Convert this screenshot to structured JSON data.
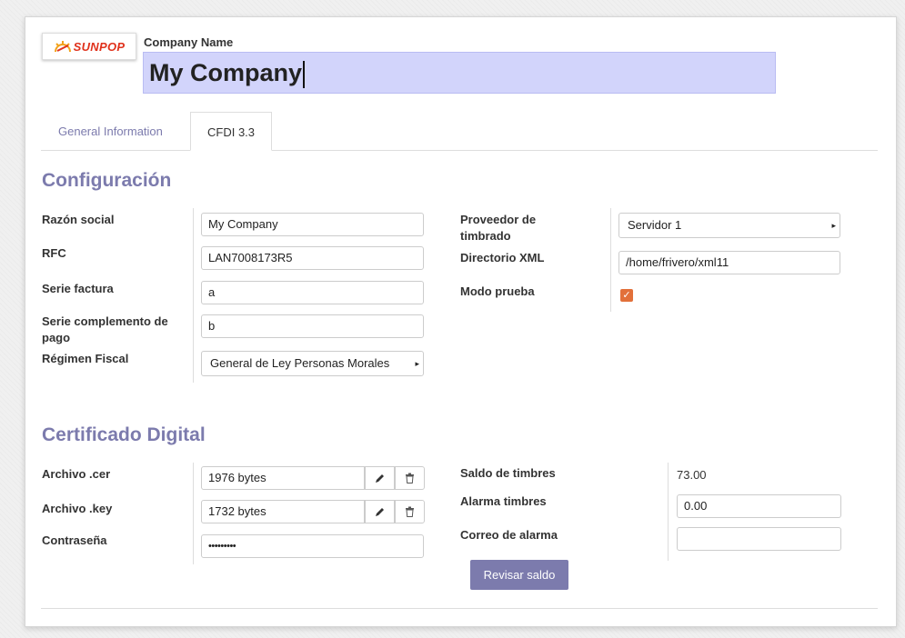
{
  "header": {
    "logo_text": "SUNPOP",
    "company_label": "Company Name",
    "company_value": "My Company"
  },
  "tabs": [
    {
      "label": "General Information",
      "active": false
    },
    {
      "label": "CFDI 3.3",
      "active": true
    }
  ],
  "configuracion": {
    "title": "Configuración",
    "razon_social": {
      "label": "Razón social",
      "value": "My Company"
    },
    "rfc": {
      "label": "RFC",
      "value": "LAN7008173R5"
    },
    "serie_factura": {
      "label": "Serie factura",
      "value": "a"
    },
    "serie_complemento": {
      "label": "Serie complemento de pago",
      "value": "b"
    },
    "regimen_fiscal": {
      "label": "Régimen Fiscal",
      "value": "General de Ley Personas Morales"
    },
    "proveedor": {
      "label": "Proveedor de timbrado",
      "value": "Servidor 1"
    },
    "directorio_xml": {
      "label": "Directorio XML",
      "value": "/home/frivero/xml11"
    },
    "modo_prueba": {
      "label": "Modo prueba",
      "checked": true
    }
  },
  "certificado": {
    "title": "Certificado Digital",
    "archivo_cer": {
      "label": "Archivo .cer",
      "value": "1976 bytes"
    },
    "archivo_key": {
      "label": "Archivo .key",
      "value": "1732 bytes"
    },
    "contrasena": {
      "label": "Contraseña",
      "value": "•••••••••"
    },
    "saldo_timbres": {
      "label": "Saldo de timbres",
      "value": "73.00"
    },
    "alarma_timbres": {
      "label": "Alarma timbres",
      "value": "0.00"
    },
    "correo_alarma": {
      "label": "Correo de alarma",
      "value": ""
    },
    "revisar_button": "Revisar saldo"
  },
  "colors": {
    "accent": "#7c7bad",
    "company_field_bg": "#d2d4fb",
    "checkbox": "#e2703a"
  }
}
